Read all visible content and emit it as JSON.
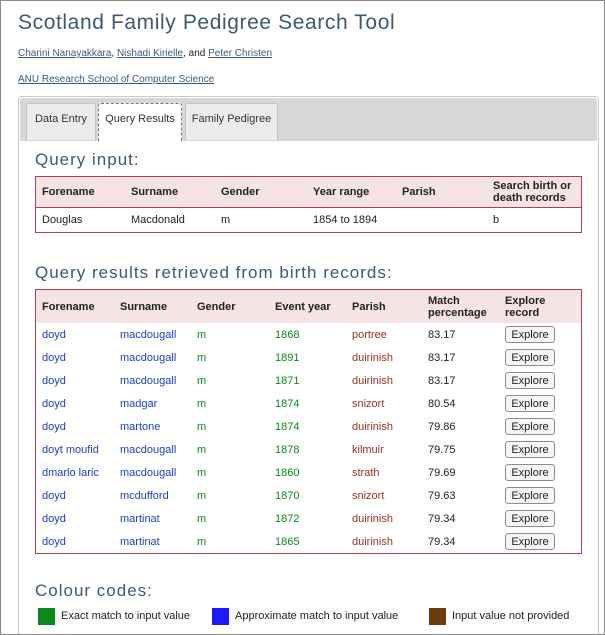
{
  "header": {
    "title": "Scotland Family Pedigree Search Tool",
    "author1": "Charini Nanayakkara",
    "sep1": ", ",
    "author2": "Nishadi Kirielle",
    "sep2": ", and ",
    "author3": "Peter Christen",
    "institution": "ANU Research School of Computer Science"
  },
  "tabs": [
    {
      "label": "Data Entry",
      "active": false
    },
    {
      "label": "Query Results",
      "active": true
    },
    {
      "label": "Family Pedigree",
      "active": false
    }
  ],
  "query_input": {
    "heading": "Query input:",
    "columns": [
      "Forename",
      "Surname",
      "Gender",
      "Year range",
      "Parish",
      "Search birth or death records"
    ],
    "row": [
      "Douglas",
      "Macdonald",
      "m",
      "1854 to 1894",
      "",
      "b"
    ]
  },
  "results": {
    "heading": "Query results retrieved from birth records:",
    "columns": [
      "Forename",
      "Surname",
      "Gender",
      "Event year",
      "Parish",
      "Match percentage",
      "Explore record"
    ],
    "button_label": "Explore",
    "rows": [
      [
        "doyd",
        "macdougall",
        "m",
        "1868",
        "portree",
        "83.17"
      ],
      [
        "doyd",
        "macdougall",
        "m",
        "1891",
        "duirinish",
        "83.17"
      ],
      [
        "doyd",
        "macdougall",
        "m",
        "1871",
        "duirinish",
        "83.17"
      ],
      [
        "doyd",
        "madgar",
        "m",
        "1874",
        "snizort",
        "80.54"
      ],
      [
        "doyd",
        "martone",
        "m",
        "1874",
        "duirinish",
        "79.86"
      ],
      [
        "doyt moufid",
        "macdougall",
        "m",
        "1878",
        "kilmuir",
        "79.75"
      ],
      [
        "dmarlo laric",
        "macdougall",
        "m",
        "1860",
        "strath",
        "79.69"
      ],
      [
        "doyd",
        "mcdufford",
        "m",
        "1870",
        "snizort",
        "79.63"
      ],
      [
        "doyd",
        "martinat",
        "m",
        "1872",
        "duirinish",
        "79.34"
      ],
      [
        "doyd",
        "martinat",
        "m",
        "1865",
        "duirinish",
        "79.34"
      ]
    ]
  },
  "colour_codes": {
    "heading": "Colour codes:",
    "items": [
      {
        "label": "Exact match to input value",
        "color": "#0a8a1a"
      },
      {
        "label": "Approximate match to input value",
        "color": "#1a1aff"
      },
      {
        "label": "Input value not provided",
        "color": "#6b3a10"
      }
    ]
  },
  "colors": {
    "title": "#3c5a78",
    "table_border": "#b33d52",
    "table_header_bg": "#f5e3e6",
    "approximate_text": "#1a3fd0",
    "exact_text": "#0a8a1a",
    "not_provided_text": "#9c3020"
  }
}
